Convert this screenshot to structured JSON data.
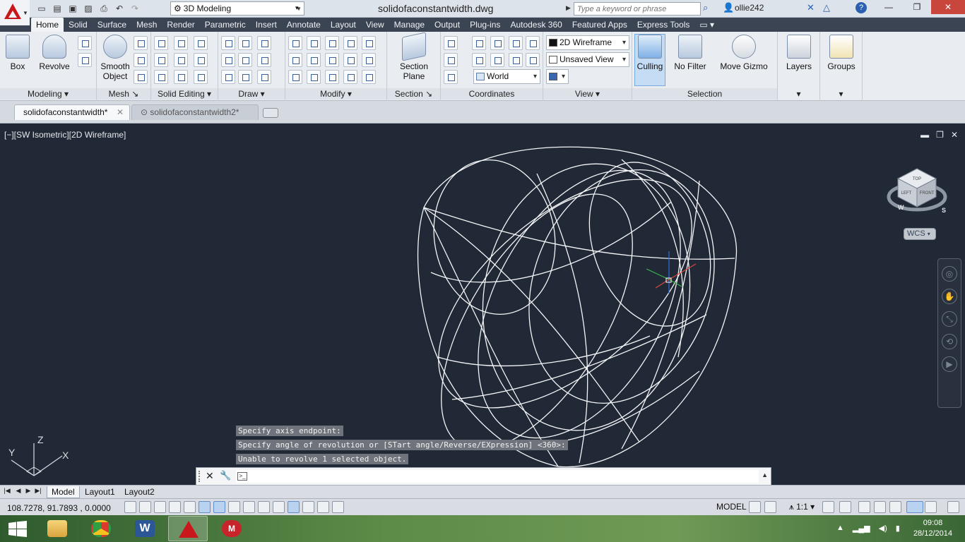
{
  "titlebar": {
    "workspace": "3D Modeling",
    "document": "solidofaconstantwidth.dwg",
    "search_placeholder": "Type a keyword or phrase",
    "user": "ollie242"
  },
  "ribbon_tabs": [
    "Home",
    "Solid",
    "Surface",
    "Mesh",
    "Render",
    "Parametric",
    "Insert",
    "Annotate",
    "Layout",
    "View",
    "Manage",
    "Output",
    "Plug-ins",
    "Autodesk 360",
    "Featured Apps",
    "Express Tools"
  ],
  "ribbon": {
    "box": "Box",
    "revolve": "Revolve",
    "smooth_object": "Smooth\nObject",
    "section_plane": "Section\nPlane",
    "visual_style": "2D Wireframe",
    "saved_view": "Unsaved View",
    "ucs_world": "World",
    "culling": "Culling",
    "no_filter": "No Filter",
    "move_gizmo": "Move Gizmo",
    "layers": "Layers",
    "groups": "Groups",
    "panels": {
      "modeling": "Modeling",
      "mesh": "Mesh",
      "solid_editing": "Solid Editing",
      "draw": "Draw",
      "modify": "Modify",
      "section": "Section",
      "coordinates": "Coordinates",
      "view": "View",
      "selection": "Selection"
    }
  },
  "file_tabs": [
    {
      "label": "solidofaconstantwidth*"
    },
    {
      "label": "solidofaconstantwidth2*"
    }
  ],
  "viewport": {
    "label": "[−][SW Isometric][2D Wireframe]",
    "viewcube": {
      "top": "TOP",
      "left": "LEFT",
      "front": "FRONT",
      "w": "W",
      "s": "S"
    },
    "wcs": "WCS",
    "ucs": {
      "z": "Z",
      "y": "Y",
      "x": "X"
    }
  },
  "command_history": [
    "Specify axis endpoint:",
    "Specify angle of revolution or [STart angle/Reverse/EXpression] <360>:",
    "Unable to revolve 1 selected object."
  ],
  "command_input": "",
  "layout_tabs": [
    "Model",
    "Layout1",
    "Layout2"
  ],
  "statusbar": {
    "coordinates": "108.7278, 91.7893 , 0.0000",
    "model": "MODEL",
    "annotation_scale": "1:1"
  },
  "taskbar": {
    "time": "09:08",
    "date": "28/12/2014"
  }
}
